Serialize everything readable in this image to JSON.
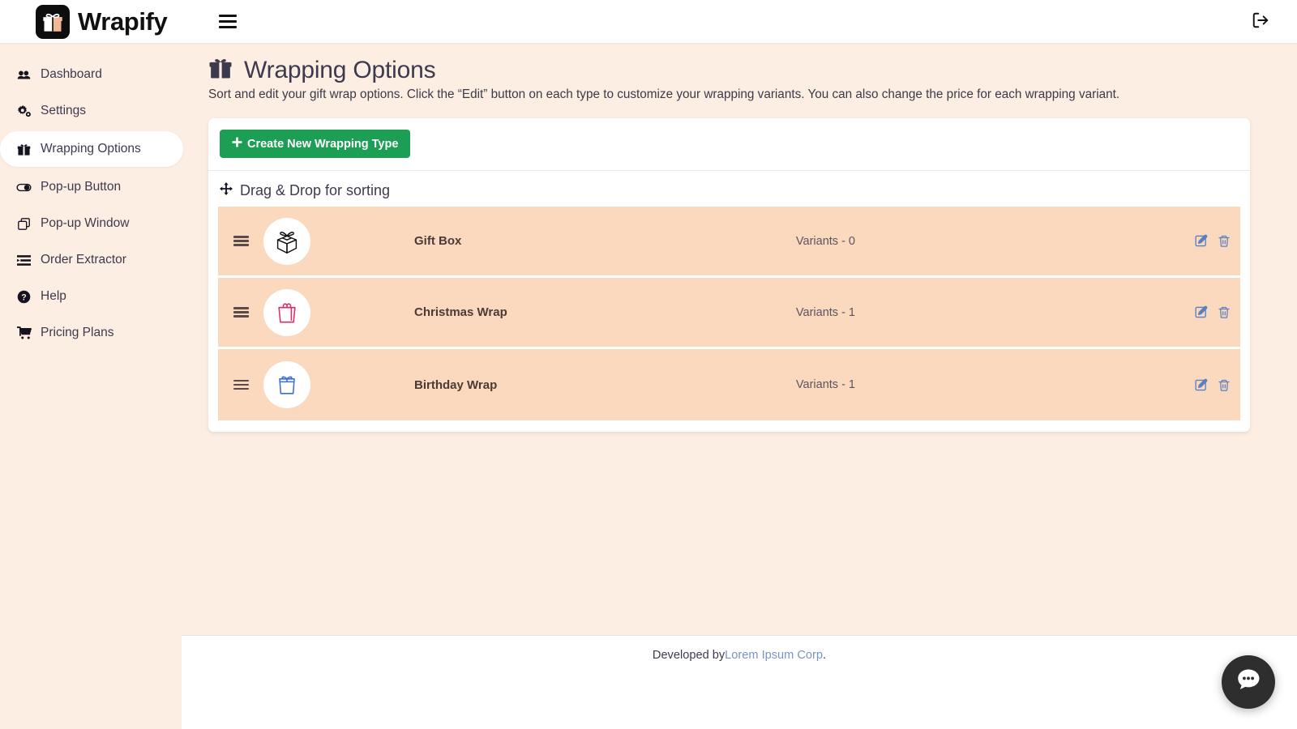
{
  "topbar": {
    "brand_name": "Wrapify",
    "logo_icon": "gift-logo-icon",
    "menu_icon": "hamburger-menu-icon",
    "logout_icon": "logout-icon"
  },
  "sidebar": {
    "items": [
      {
        "label": "Dashboard",
        "icon": "dashboard-icon",
        "active": false
      },
      {
        "label": "Settings",
        "icon": "gears-icon",
        "active": false
      },
      {
        "label": "Wrapping Options",
        "icon": "gift-icon",
        "active": true
      },
      {
        "label": "Pop-up Button",
        "icon": "toggle-icon",
        "active": false
      },
      {
        "label": "Pop-up Window",
        "icon": "windows-copy-icon",
        "active": false
      },
      {
        "label": "Order Extractor",
        "icon": "list-icon",
        "active": false
      },
      {
        "label": "Help",
        "icon": "question-circle-icon",
        "active": false
      },
      {
        "label": "Pricing Plans",
        "icon": "cart-icon",
        "active": false
      }
    ]
  },
  "page": {
    "title": "Wrapping Options",
    "title_icon": "gift-icon",
    "subtitle": "Sort and edit your gift wrap options. Click the “Edit” button on each type to customize your wrapping variants. You can also change the price for each wrapping variant."
  },
  "card": {
    "create_button_label": "Create New Wrapping Type",
    "create_button_icon": "plus-icon",
    "create_button_color": "#1c9e54",
    "drag_label": "Drag & Drop for sorting",
    "drag_icon": "arrows-move-icon",
    "row_bg_color": "#fbd9bf"
  },
  "wrapping_types": [
    {
      "name": "Gift Box",
      "variants_label": "Variants - 0",
      "thumb_icon": "gift-box-outline-icon",
      "thumb_color": "#111111",
      "handle_icon": "drag-handle-icon",
      "edit_icon": "edit-pencil-icon",
      "delete_icon": "trash-icon"
    },
    {
      "name": "Christmas Wrap",
      "variants_label": "Variants - 1",
      "thumb_icon": "shopping-bag-icon",
      "thumb_color": "#e3286a",
      "handle_icon": "drag-handle-icon",
      "edit_icon": "edit-pencil-icon",
      "delete_icon": "trash-icon"
    },
    {
      "name": "Birthday Wrap",
      "variants_label": "Variants - 1",
      "thumb_icon": "gift-bag-bow-icon",
      "thumb_color": "#3b6fd4",
      "handle_icon": "drag-handle-icon",
      "edit_icon": "edit-pencil-icon",
      "delete_icon": "trash-icon"
    }
  ],
  "footer": {
    "text_prefix": "Developed by ",
    "link_label": "Lorem Ipsum Corp",
    "text_suffix": "."
  },
  "chat_widget": {
    "icon": "chat-bubble-icon",
    "color": "#2e2e2e"
  }
}
